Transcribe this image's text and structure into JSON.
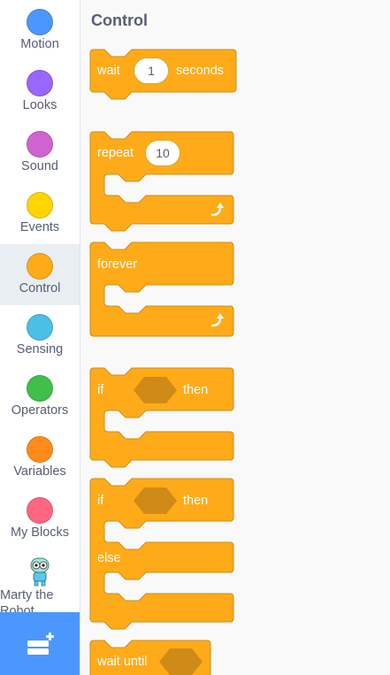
{
  "categories": [
    {
      "label": "Motion",
      "color": "#4c97ff",
      "icon": "motion-category-circle"
    },
    {
      "label": "Looks",
      "color": "#9966ff",
      "icon": "looks-category-circle"
    },
    {
      "label": "Sound",
      "color": "#cf63cf",
      "icon": "sound-category-circle"
    },
    {
      "label": "Events",
      "color": "#ffd500",
      "icon": "events-category-circle"
    },
    {
      "label": "Control",
      "color": "#ffab19",
      "icon": "control-category-circle",
      "selected": true
    },
    {
      "label": "Sensing",
      "color": "#4cbfe6",
      "icon": "sensing-category-circle"
    },
    {
      "label": "Operators",
      "color": "#40bf4a",
      "icon": "operators-category-circle"
    },
    {
      "label": "Variables",
      "color": "#ff8c1a",
      "icon": "variables-category-circle"
    },
    {
      "label": "My Blocks",
      "color": "#ff6680",
      "icon": "my-blocks-category-circle"
    }
  ],
  "robot_category": {
    "label": "Marty the Robot",
    "icon": "marty-robot-icon"
  },
  "extension_button": {
    "icon": "add-extension-icon",
    "color": "#4c97ff"
  },
  "palette": {
    "title": "Control",
    "block_color": "#ffab19",
    "block_border": "#cf8b17",
    "hexagon_color": "#cf8b17",
    "blocks": {
      "wait": {
        "label": "wait",
        "value": "1",
        "suffix": "seconds"
      },
      "repeat": {
        "label": "repeat",
        "value": "10",
        "icon": "loop-arrow-icon"
      },
      "forever": {
        "label": "forever",
        "icon": "loop-arrow-icon"
      },
      "if_then": {
        "label": "if",
        "suffix": "then"
      },
      "if_else": {
        "label": "if",
        "suffix": "then",
        "else_label": "else"
      },
      "wait_until": {
        "label": "wait until"
      }
    }
  }
}
